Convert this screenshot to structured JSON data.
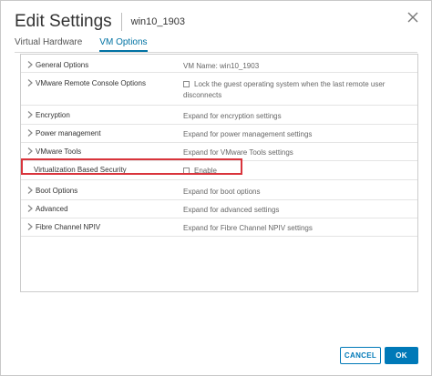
{
  "dialog": {
    "title": "Edit Settings",
    "vm_name": "win10_1903"
  },
  "tabs": [
    {
      "label": "Virtual Hardware",
      "active": false
    },
    {
      "label": "VM Options",
      "active": true
    }
  ],
  "options": {
    "general": {
      "label": "General Options",
      "value": "VM Name: win10_1903"
    },
    "remote_console": {
      "label": "VMware Remote Console Options",
      "value_line1": "Lock the guest operating system when the last remote user",
      "value_line2": "disconnects"
    },
    "encryption": {
      "label": "Encryption",
      "value": "Expand for encryption settings"
    },
    "power": {
      "label": "Power management",
      "value": "Expand for power management settings"
    },
    "tools": {
      "label": "VMware Tools",
      "value": "Expand for VMware Tools settings"
    },
    "vbs": {
      "label": "Virtualization Based Security",
      "value": "Enable"
    },
    "boot": {
      "label": "Boot Options",
      "value": "Expand for boot options"
    },
    "advanced": {
      "label": "Advanced",
      "value": "Expand for advanced settings"
    },
    "npiv": {
      "label": "Fibre Channel NPIV",
      "value": "Expand for Fibre Channel NPIV settings"
    }
  },
  "footer": {
    "cancel_label": "CANCEL",
    "ok_label": "OK"
  },
  "colors": {
    "accent": "#0079b8",
    "highlight": "#d9343c"
  },
  "icons": [
    "close-icon",
    "chevron-right-icon",
    "checkbox-icon"
  ]
}
